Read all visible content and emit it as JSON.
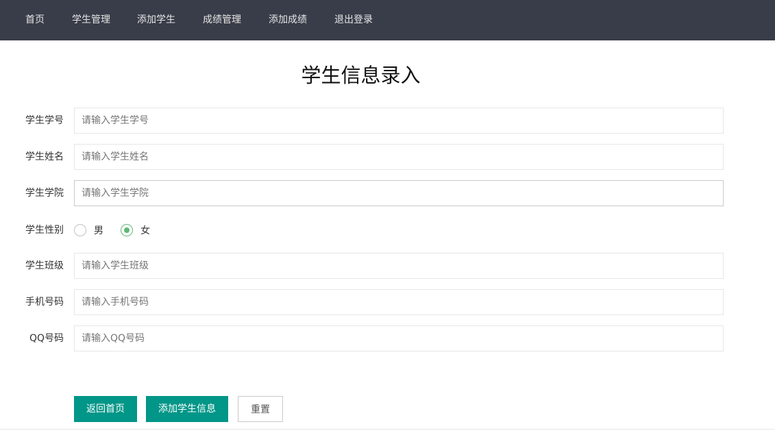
{
  "nav": {
    "items": [
      {
        "label": "首页"
      },
      {
        "label": "学生管理"
      },
      {
        "label": "添加学生"
      },
      {
        "label": "成绩管理"
      },
      {
        "label": "添加成绩"
      },
      {
        "label": "退出登录"
      }
    ]
  },
  "form": {
    "title": "学生信息录入",
    "fields": {
      "student_id": {
        "label": "学生学号",
        "placeholder": "请输入学生学号",
        "value": ""
      },
      "name": {
        "label": "学生姓名",
        "placeholder": "请输入学生姓名",
        "value": ""
      },
      "college": {
        "label": "学生学院",
        "placeholder": "请输入学生学院",
        "value": ""
      },
      "gender": {
        "label": "学生性别",
        "options": [
          {
            "label": "男",
            "checked": false
          },
          {
            "label": "女",
            "checked": true
          }
        ]
      },
      "class": {
        "label": "学生班级",
        "placeholder": "请输入学生班级",
        "value": ""
      },
      "phone": {
        "label": "手机号码",
        "placeholder": "请输入手机号码",
        "value": ""
      },
      "qq": {
        "label": "QQ号码",
        "placeholder": "请输入QQ号码",
        "value": ""
      }
    },
    "buttons": {
      "back": "返回首页",
      "submit": "添加学生信息",
      "reset": "重置"
    }
  },
  "colors": {
    "nav_bg": "#393d49",
    "primary": "#009688",
    "radio_checked": "#5fb878"
  }
}
